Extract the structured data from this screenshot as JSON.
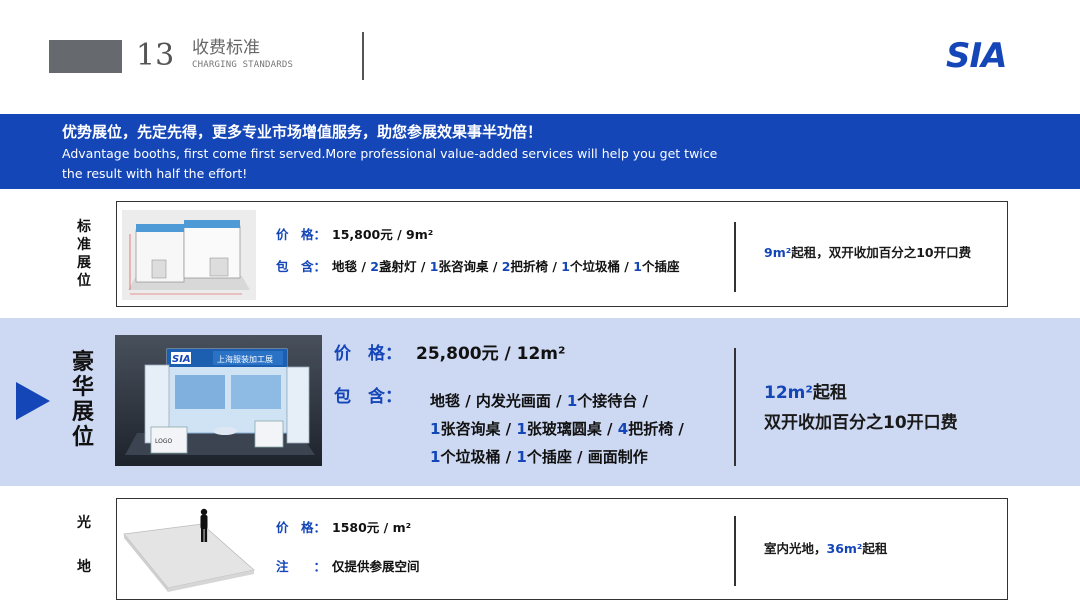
{
  "header": {
    "number": "13",
    "title": "收费标准",
    "subtitle": "CHARGING STANDARDS",
    "logo_text": "SIA"
  },
  "banner": {
    "cn": "优势展位，先定先得，更多专业市场增值服务，助您参展效果事半功倍！",
    "en_line1": "Advantage booths, first come first served.More professional value-added services will help you get twice",
    "en_line2": "the result with half the effort!"
  },
  "standard": {
    "label_chars": [
      "标",
      "准",
      "展",
      "位"
    ],
    "price_label": "价　格：",
    "price_value": "15,800元 / 9m²",
    "include_label": "包　含：",
    "include_parts": [
      {
        "t": "地毯 / ",
        "b": false
      },
      {
        "t": "2",
        "b": true
      },
      {
        "t": "盏射灯 / ",
        "b": false
      },
      {
        "t": "1",
        "b": true
      },
      {
        "t": "张咨询桌 / ",
        "b": false
      },
      {
        "t": "2",
        "b": true
      },
      {
        "t": "把折椅 / ",
        "b": false
      },
      {
        "t": "1",
        "b": true
      },
      {
        "t": "个垃圾桶 / ",
        "b": false
      },
      {
        "t": "1",
        "b": true
      },
      {
        "t": "个插座",
        "b": false
      }
    ],
    "note_num": "9m²",
    "note_rest": "起租，双开收加百分之10开口费"
  },
  "deluxe": {
    "label_chars": [
      "豪",
      "华",
      "展",
      "位"
    ],
    "price_label": "价　格：",
    "price_value": "25,800元 / 12m²",
    "include_label": "包　含：",
    "line1": [
      {
        "t": "地毯 / 内发光画面 / ",
        "b": false
      },
      {
        "t": "1",
        "b": true
      },
      {
        "t": "个接待台 /",
        "b": false
      }
    ],
    "line2": [
      {
        "t": "1",
        "b": true
      },
      {
        "t": "张咨询桌 / ",
        "b": false
      },
      {
        "t": "1",
        "b": true
      },
      {
        "t": "张玻璃圆桌 / ",
        "b": false
      },
      {
        "t": "4",
        "b": true
      },
      {
        "t": "把折椅 /",
        "b": false
      }
    ],
    "line3": [
      {
        "t": "1",
        "b": true
      },
      {
        "t": "个垃圾桶 / ",
        "b": false
      },
      {
        "t": "1",
        "b": true
      },
      {
        "t": "个插座 / 画面制作",
        "b": false
      }
    ],
    "note1_num": "12m²",
    "note1_rest": "起租",
    "note2": "双开收加百分之10开口费",
    "booth_sign": "上海服装加工展",
    "logo_box": "LOGO"
  },
  "raw": {
    "label_chars": [
      "光",
      "地"
    ],
    "price_label": "价　格：",
    "price_value": "1580元 / m²",
    "note_label": "注　　：",
    "note_value": "仅提供参展空间",
    "side_text": "室内光地，",
    "side_num": "36m²",
    "side_rest": "起租"
  },
  "colors": {
    "brand_blue": "#1446b8",
    "highlight_bg": "#cdd8f2"
  }
}
